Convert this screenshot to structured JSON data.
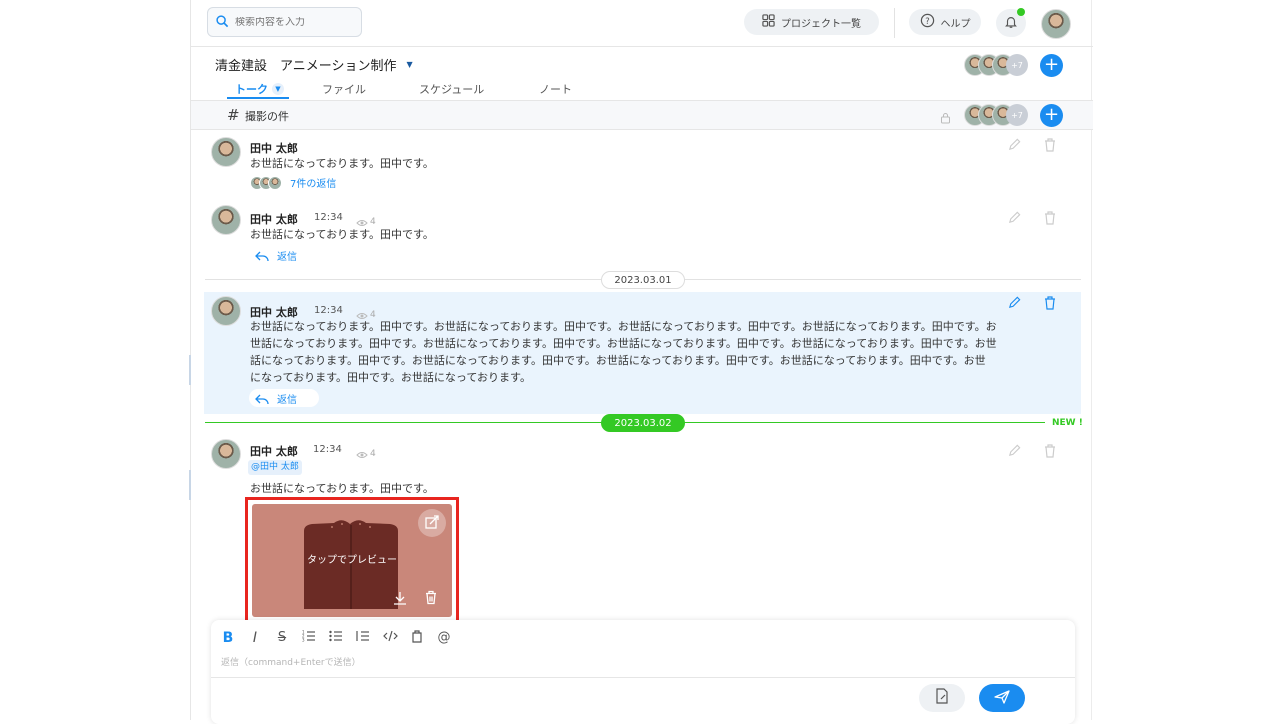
{
  "header": {
    "search_placeholder": "検索内容を入力",
    "project_list_label": "プロジェクト一覧",
    "help_label": "ヘルプ"
  },
  "project": {
    "title": "清金建設　アニメーション制作",
    "member_overflow": "+7",
    "tabs": [
      {
        "label": "トーク"
      },
      {
        "label": "ファイル"
      },
      {
        "label": "スケジュール"
      },
      {
        "label": "ノート"
      }
    ]
  },
  "channel": {
    "name": "撮影の件",
    "member_overflow": "+7"
  },
  "messages": [
    {
      "author": "田中 太郎",
      "text": "お世話になっております。田中です。",
      "replies_label": "7件の返信"
    },
    {
      "author": "田中 太郎",
      "time": "12:34",
      "views": "4",
      "text": "お世話になっております。田中です。",
      "reply_label": "返信"
    },
    {
      "author": "田中 太郎",
      "time": "12:34",
      "views": "4",
      "text_lines": [
        "お世話になっております。田中です。お世話になっております。田中です。お世話になっております。田中です。お世話になっております。田中です。お",
        "世話になっております。田中です。お世話になっております。田中です。お世話になっております。田中です。お世話になっております。田中です。お世",
        "話になっております。田中です。お世話になっております。田中です。お世話になっております。田中です。お世話になっております。田中です。お世",
        "になっております。田中です。お世話になっております。"
      ],
      "reply_label": "返信"
    },
    {
      "author": "田中 太郎",
      "time": "12:34",
      "views": "4",
      "mention": "@田中 太郎",
      "text": "お世話になっております。田中です。",
      "preview_label": "タップでプレビュー"
    }
  ],
  "dates": {
    "first": "2023.03.01",
    "second": "2023.03.02",
    "new_label": "NEW !"
  },
  "composer": {
    "placeholder": "返信（command+Enterで送信）"
  },
  "colors": {
    "accent": "#1a8cf0",
    "new_divider": "#34c924",
    "highlight_bg": "#eaf4fd",
    "image_bg": "#c9877a",
    "image_shape": "#6b2b25",
    "annotation": "#e8251f"
  }
}
